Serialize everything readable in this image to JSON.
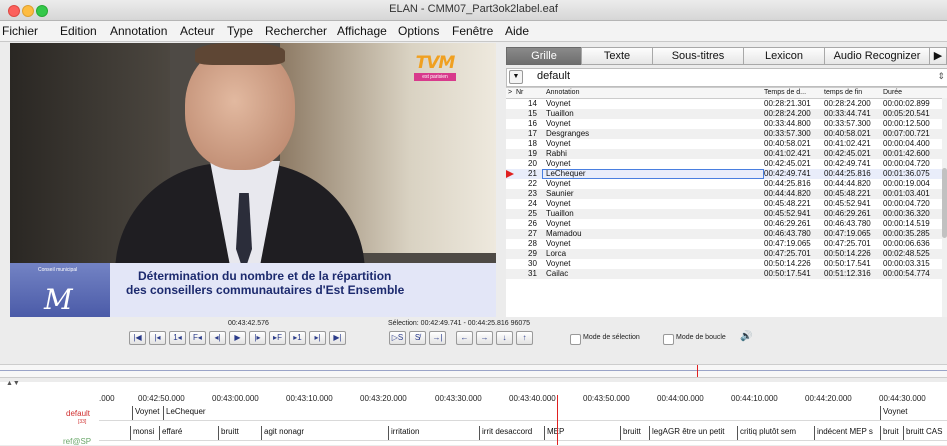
{
  "window": {
    "title": "ELAN - CMM07_Part3ok2label.eaf"
  },
  "menu": [
    "Fichier",
    "Edition",
    "Annotation",
    "Acteur",
    "Type",
    "Rechercher",
    "Affichage",
    "Options",
    "Fenêtre",
    "Aide"
  ],
  "video": {
    "channel_logo": "TVM",
    "channel_sub": "est parisien",
    "org_label": "Conseil municipal",
    "caption_line1": "Détermination du nombre et de la répartition",
    "caption_line2": "des conseillers communautaires d'Est Ensemble"
  },
  "player": {
    "current_time": "00:43:42.576",
    "selection": "Sélection: 00:42:49.741 - 00:44:25.816  96075",
    "selection_mode": "Mode de sélection",
    "loop_mode": "Mode de boucle"
  },
  "tabs": [
    {
      "label": "Grille",
      "active": true
    },
    {
      "label": "Texte",
      "active": false
    },
    {
      "label": "Sous-titres",
      "active": false
    },
    {
      "label": "Lexicon",
      "active": false
    },
    {
      "label": "Audio Recognizer",
      "active": false
    }
  ],
  "tier_select": {
    "value": "default"
  },
  "grid": {
    "headers": [
      ">",
      "Nr",
      "Annotation",
      "Temps de d...",
      "temps de fin",
      "Durée"
    ],
    "rows": [
      {
        "nr": "14",
        "ann": "Voynet",
        "start": "00:28:21.301",
        "end": "00:28:24.200",
        "dur": "00:00:02.899"
      },
      {
        "nr": "15",
        "ann": "Tuaillon",
        "start": "00:28:24.200",
        "end": "00:33:44.741",
        "dur": "00:05:20.541"
      },
      {
        "nr": "16",
        "ann": "Voynet",
        "start": "00:33:44.800",
        "end": "00:33:57.300",
        "dur": "00:00:12.500"
      },
      {
        "nr": "17",
        "ann": "Desgranges",
        "start": "00:33:57.300",
        "end": "00:40:58.021",
        "dur": "00:07:00.721"
      },
      {
        "nr": "18",
        "ann": "Voynet",
        "start": "00:40:58.021",
        "end": "00:41:02.421",
        "dur": "00:00:04.400"
      },
      {
        "nr": "19",
        "ann": "Rabhi",
        "start": "00:41:02.421",
        "end": "00:42:45.021",
        "dur": "00:01:42.600"
      },
      {
        "nr": "20",
        "ann": "Voynet",
        "start": "00:42:45.021",
        "end": "00:42:49.741",
        "dur": "00:00:04.720"
      },
      {
        "nr": "21",
        "ann": "LeChequer",
        "start": "00:42:49.741",
        "end": "00:44:25.816",
        "dur": "00:01:36.075",
        "selected": true
      },
      {
        "nr": "22",
        "ann": "Voynet",
        "start": "00:44:25.816",
        "end": "00:44:44.820",
        "dur": "00:00:19.004"
      },
      {
        "nr": "23",
        "ann": "Saunier",
        "start": "00:44:44.820",
        "end": "00:45:48.221",
        "dur": "00:01:03.401"
      },
      {
        "nr": "24",
        "ann": "Voynet",
        "start": "00:45:48.221",
        "end": "00:45:52.941",
        "dur": "00:00:04.720"
      },
      {
        "nr": "25",
        "ann": "Tuaillon",
        "start": "00:45:52.941",
        "end": "00:46:29.261",
        "dur": "00:00:36.320"
      },
      {
        "nr": "26",
        "ann": "Voynet",
        "start": "00:46:29.261",
        "end": "00:46:43.780",
        "dur": "00:00:14.519"
      },
      {
        "nr": "27",
        "ann": "Mamadou",
        "start": "00:46:43.780",
        "end": "00:47:19.065",
        "dur": "00:00:35.285"
      },
      {
        "nr": "28",
        "ann": "Voynet",
        "start": "00:47:19.065",
        "end": "00:47:25.701",
        "dur": "00:00:06.636"
      },
      {
        "nr": "29",
        "ann": "Lorca",
        "start": "00:47:25.701",
        "end": "00:50:14.226",
        "dur": "00:02:48.525"
      },
      {
        "nr": "30",
        "ann": "Voynet",
        "start": "00:50:14.226",
        "end": "00:50:17.541",
        "dur": "00:00:03.315"
      },
      {
        "nr": "31",
        "ann": "Cailac",
        "start": "00:50:17.541",
        "end": "00:51:12.316",
        "dur": "00:00:54.774"
      }
    ]
  },
  "timeline": {
    "ticks": [
      "00:42:50.000",
      "00:43:00.000",
      "00:43:10.000",
      "00:43:20.000",
      "00:43:30.000",
      "00:43:40.000",
      "00:43:50.000",
      "00:44:00.000",
      "00:44:10.000",
      "00:44:20.000",
      "00:44:30.000"
    ],
    "left_tick": ".000",
    "tiers": [
      {
        "name": "default",
        "count": "[33]",
        "annotations": [
          "Voynet",
          "LeChequer",
          "Voynet"
        ]
      },
      {
        "name": "ref@SP",
        "annotations": [
          "monsi",
          "effaré",
          "bruitt",
          "agit nonagr",
          "irritation",
          "irrit desaccord",
          "MEP",
          "bruitt",
          "legAGR être un petit",
          "critiq plutôt sem",
          "indécent MEP s",
          "bruit",
          "bruitt CAS"
        ]
      }
    ]
  },
  "colors": {
    "tab_active": "#7c7c7c",
    "selection_border": "#4a7fe0",
    "play_marker": "#e02020",
    "tier_name": "#d03030"
  }
}
